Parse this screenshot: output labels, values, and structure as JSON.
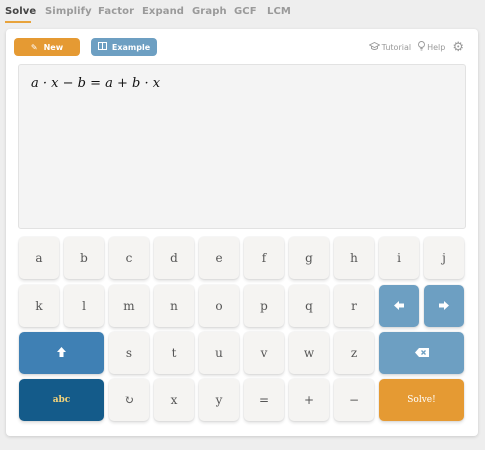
{
  "tabs": [
    {
      "label": "Solve"
    },
    {
      "label": "Simplify"
    },
    {
      "label": "Factor"
    },
    {
      "label": "Expand"
    },
    {
      "label": "Graph"
    },
    {
      "label": "GCF"
    },
    {
      "label": "LCM"
    }
  ],
  "toolbar": {
    "new_label": "New",
    "example_label": "Example",
    "tutorial_label": "Tutorial",
    "help_label": "Help"
  },
  "editor": {
    "expression": "a · x − b = a + b · x"
  },
  "keypad": {
    "row1": [
      "a",
      "b",
      "c",
      "d",
      "e",
      "f",
      "g",
      "h",
      "i",
      "j"
    ],
    "row2": [
      "k",
      "l",
      "m",
      "n",
      "o",
      "p",
      "q",
      "r"
    ],
    "row3": [
      "s",
      "t",
      "u",
      "v",
      "w",
      "z"
    ],
    "row4": {
      "abc": "abc",
      "undo": "↻",
      "x": "x",
      "y": "y",
      "equals": "=",
      "plus": "+",
      "minus": "−",
      "solve": "Solve!"
    }
  },
  "colors": {
    "accent_orange": "#e59a33",
    "accent_blue": "#6d9fc2",
    "shift_blue": "#3f80b4",
    "abc_navy": "#145b8a"
  }
}
